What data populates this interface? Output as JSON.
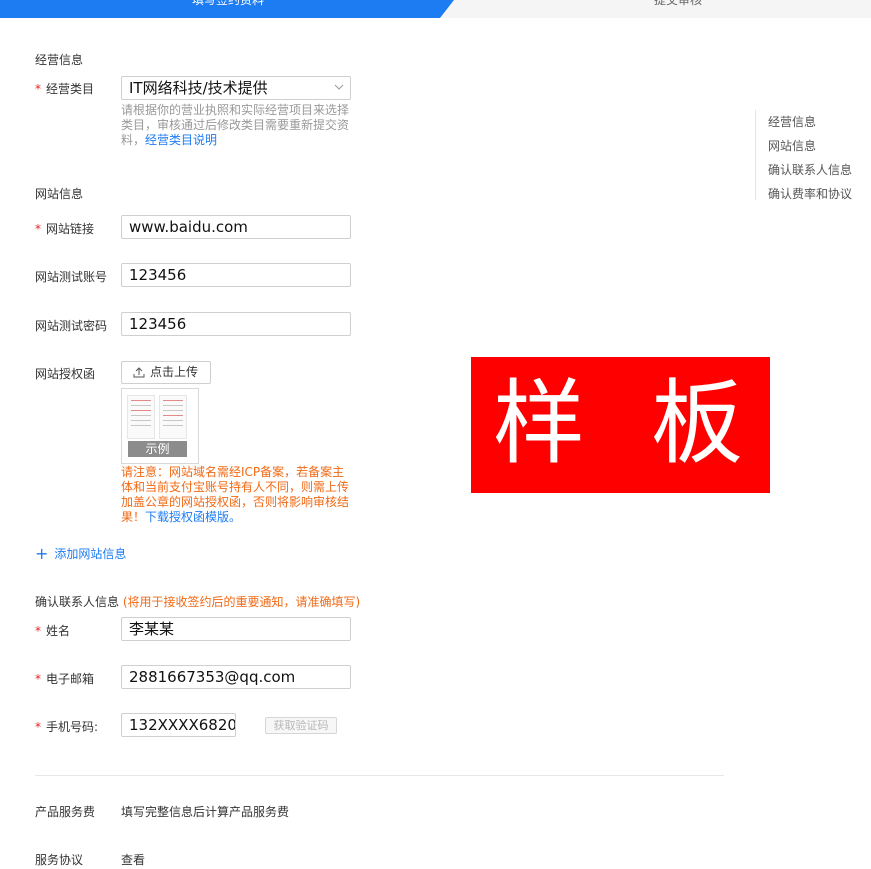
{
  "steps": [
    {
      "label": "填写签约资料",
      "active": true
    },
    {
      "label": "提交审核",
      "active": false
    }
  ],
  "colors": {
    "accent": "#1e7cf2",
    "warning": "#f06a16",
    "required": "#e22222",
    "stamp": "#ff0000"
  },
  "business": {
    "section_title": "经营信息",
    "category_label": "经营类目",
    "category_value": "IT网络科技/技术提供",
    "hint_text": "请根据你的营业执照和实际经营项目来选择类目，审核通过后修改类目需要重新提交资料，",
    "hint_link": "经营类目说明"
  },
  "website": {
    "section_title": "网站信息",
    "url_label": "网站链接",
    "url_value": "www.baidu.com",
    "test_account_label": "网站测试账号",
    "test_account_value": "123456",
    "test_password_label": "网站测试密码",
    "test_password_value": "123456",
    "auth_label": "网站授权函",
    "upload_label": "点击上传",
    "sample_caption": "示例",
    "notice_text": "请注意：网站域名需经ICP备案，若备案主体和当前支付宝账号持有人不同，则需上传加盖公章的网站授权函，否则将影响审核结果！",
    "notice_link": "下载授权函模版。",
    "add_label": "添加网站信息"
  },
  "contact": {
    "section_title": "确认联系人信息",
    "section_note": "(将用于接收签约后的重要通知，请准确填写)",
    "name_label": "姓名",
    "name_value": "李某某",
    "email_label": "电子邮箱",
    "email_value": "2881667353@qq.com",
    "phone_label": "手机号码:",
    "phone_value": "132XXXX6820",
    "code_button": "获取验证码"
  },
  "fee": {
    "label": "产品服务费",
    "value": "填写完整信息后计算产品服务费"
  },
  "agreement": {
    "label": "服务协议",
    "value": "查看"
  },
  "anchor_nav": [
    "经营信息",
    "网站信息",
    "确认联系人信息",
    "确认费率和协议"
  ],
  "watermark": {
    "text": "样 板",
    "char1": "样",
    "char2": "板"
  }
}
